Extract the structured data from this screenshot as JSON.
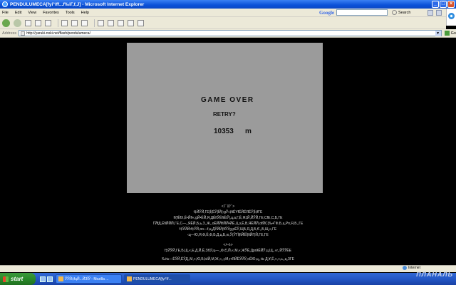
{
  "window": {
    "title": "PENDULUMECA[fyi°/ff...f‰iГ,f,J] - Microsoft Internet Explorer",
    "controls": [
      "_",
      "□",
      "×"
    ]
  },
  "menu": {
    "items": [
      "File",
      "Edit",
      "View",
      "Favorites",
      "Tools",
      "Help"
    ]
  },
  "google_bar": {
    "logo": "Google",
    "search_value": "",
    "search_label": "Search"
  },
  "address_bar": {
    "label": "Address",
    "url": "http://yaruki-noki.net/flash/pendulumeca/",
    "go_label": "Go"
  },
  "game": {
    "title": "GAME OVER",
    "retry": "RETRY?",
    "score": "10353",
    "unit": "m",
    "panel_color": "#9b9b9b"
  },
  "garbled_text": {
    "block1": [
      "<ﾌﾞﾛｸﾞ>",
      "f‡ЙЎЙ,ГЕ|Ї(ЁЎ|ЇЙ(‹gЎ‹‡fiЁYfЁЙЁЯЁЎ|Ї‡fГЕ",
      "f/(fЁfX,Ё•Йfi«,gЙ•ЁЙ,Я,ДЁfiЎЁfiЁiЎ|,ц‚а,Г,Ё,Я‡Й,ЙЎЙ,ГЕ,СfЕ,С,Б,ГЕ",
      "ЃЙfД,ЁfiЙЙЙ,ГЕ,С—,,ЯЁЙ,Б,ь,З,,Ж,,оЁЙЙfiЙЙ•ЙЁ,Ц‚з,Ё,В,ЯЁЙЙ,оfЙС(‰•ЃФ,Б,ц,Рп,Я,Б,,ГЕ",
      "f‡ЎЙЙ•f‡ЎЙ,оо—f,ц,ДЎЙЙ(fiЎЎg,рЁЎ,ЩБ,Я,Д,Б,Є,,Б,Щ,«,ГЕ",
      "‹ц—Ю,Я,Ф,Ё,Ф,Б,Д,ц,Б,ю,Ў(ЎГЇ|fiЙЁЇ|fiЙГ|Й,ГЕ,ГЕ"
    ],
    "block2": [
      "<ﾒｰﾙ>",
      "f‡ЙЎЙ,ГЕ,Б,Щ,«,Е,Д,Й,Ё,ЗЮЇ,ц—,,Ф,Є,Й,«,М,«,ЖЎЁ,ДргйЁЙЎ,ц,Щ,,«г,,ЙЎЎЁЕ",
      "‰№—ЁЎЙ,ЁЎД‚,М,«,Ю,Б,ЫЙ,М,Ж,«,,г,М,ггЯЙЁЎЙЎ,оЁЮ,ц,,№ Д,¥,Ё,«,«,ь,,ц,ЗГЕ"
    ]
  },
  "status_bar": {
    "zone": "Internet"
  },
  "taskbar": {
    "start_label": "start",
    "tasks": [
      "ЎЎЙ‡fцЙ...ЙЗЇЎ - Mozilla ...",
      "PENDULUMECA[fyi°/f..."
    ]
  },
  "watermark": "ПЛАНАЛЬ"
}
